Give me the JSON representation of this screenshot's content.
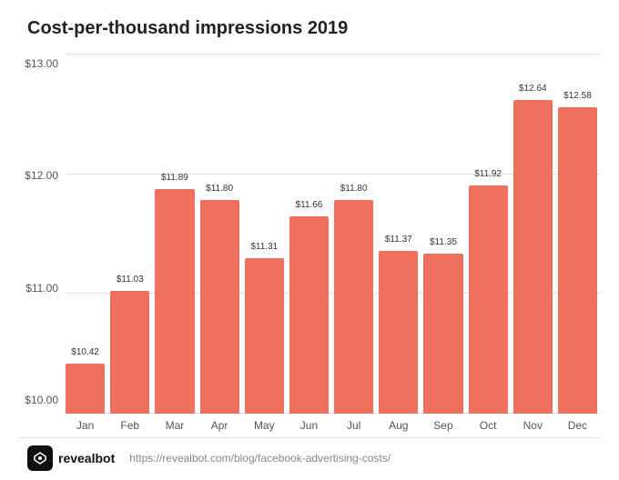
{
  "title": "Cost-per-thousand impressions 2019",
  "y_axis": {
    "labels": [
      "$13.00",
      "$12.00",
      "$11.00",
      "$10.00"
    ]
  },
  "bars": [
    {
      "month": "Jan",
      "value": 10.42,
      "label": "$10.42",
      "height_pct": 14
    },
    {
      "month": "Feb",
      "value": 11.03,
      "label": "$11.03",
      "height_pct": 34.3
    },
    {
      "month": "Mar",
      "value": 11.89,
      "label": "$11.89",
      "height_pct": 62.7
    },
    {
      "month": "Apr",
      "value": 11.8,
      "label": "$11.80",
      "height_pct": 59.7
    },
    {
      "month": "May",
      "value": 11.31,
      "label": "$11.31",
      "height_pct": 43.3
    },
    {
      "month": "Jun",
      "value": 11.66,
      "label": "$11.66",
      "height_pct": 55.0
    },
    {
      "month": "Jul",
      "value": 11.8,
      "label": "$11.80",
      "height_pct": 59.7
    },
    {
      "month": "Aug",
      "value": 11.37,
      "label": "$11.37",
      "height_pct": 45.3
    },
    {
      "month": "Sep",
      "value": 11.35,
      "label": "$11.35",
      "height_pct": 44.7
    },
    {
      "month": "Oct",
      "value": 11.92,
      "label": "$11.92",
      "height_pct": 64.0
    },
    {
      "month": "Nov",
      "value": 12.64,
      "label": "$12.64",
      "height_pct": 88.0
    },
    {
      "month": "Dec",
      "value": 12.58,
      "label": "$12.58",
      "height_pct": 86.0
    }
  ],
  "footer": {
    "logo_text": "revealbot",
    "url": "https://revealbot.com/blog/facebook-advertising-costs/"
  },
  "bar_color": "#f07060",
  "y_min": 10.0,
  "y_max": 13.0
}
